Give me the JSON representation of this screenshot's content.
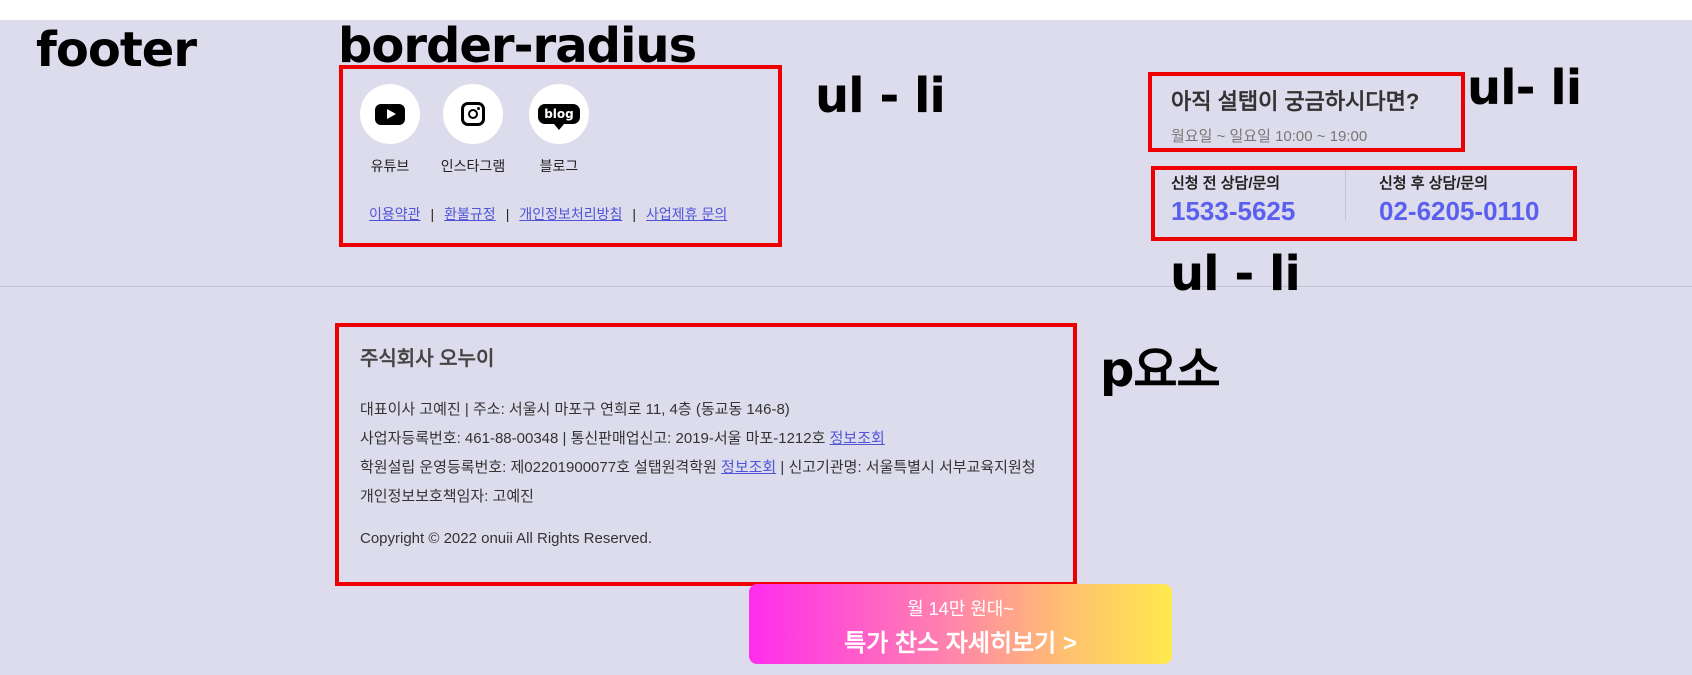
{
  "annotations": {
    "footer": "footer",
    "border_radius": "border-radius",
    "ul_li_1": "ul - li",
    "ul_li_2": "ul- li",
    "ul_li_3": "ul - li",
    "p_element": "p요소"
  },
  "social": [
    {
      "label": "유튜브",
      "icon": "youtube-icon"
    },
    {
      "label": "인스타그램",
      "icon": "instagram-icon"
    },
    {
      "label": "블로그",
      "icon": "blog-icon",
      "icon_text": "blog"
    }
  ],
  "links": [
    "이용약관",
    "환불규정",
    "개인정보처리방침",
    "사업제휴 문의"
  ],
  "link_separator": "|",
  "inquiry": {
    "title": "아직 설탭이 궁금하시다면?",
    "hours": "월요일 ~ 일요일 10:00 ~ 19:00"
  },
  "phones": [
    {
      "label": "신청 전 상담/문의",
      "number": "1533-5625"
    },
    {
      "label": "신청 후 상담/문의",
      "number": "02-6205-0110"
    }
  ],
  "company": {
    "name": "주식회사 오누이",
    "line1": "대표이사 고예진 | 주소: 서울시 마포구 연희로 11, 4층 (동교동 146-8)",
    "line2_pre": "사업자등록번호: 461-88-00348 | 통신판매업신고: 2019-서울 마포-1212호 ",
    "line2_link": "정보조회",
    "line3_pre": "학원설립 운영등록번호: 제02201900077호 설탭원격학원 ",
    "line3_link": "정보조회",
    "line3_post": " | 신고기관명: 서울특별시 서부교육지원청",
    "line4": "개인정보보호책임자: 고예진",
    "copyright": "Copyright © 2022 onuii All Rights Reserved."
  },
  "cta": {
    "sub": "월 14만 원대~",
    "main": "특가 찬스 자세히보기 >"
  },
  "colors": {
    "background": "#dddcec",
    "accent": "#5a5ff0",
    "annotation_box": "#ee0000"
  }
}
